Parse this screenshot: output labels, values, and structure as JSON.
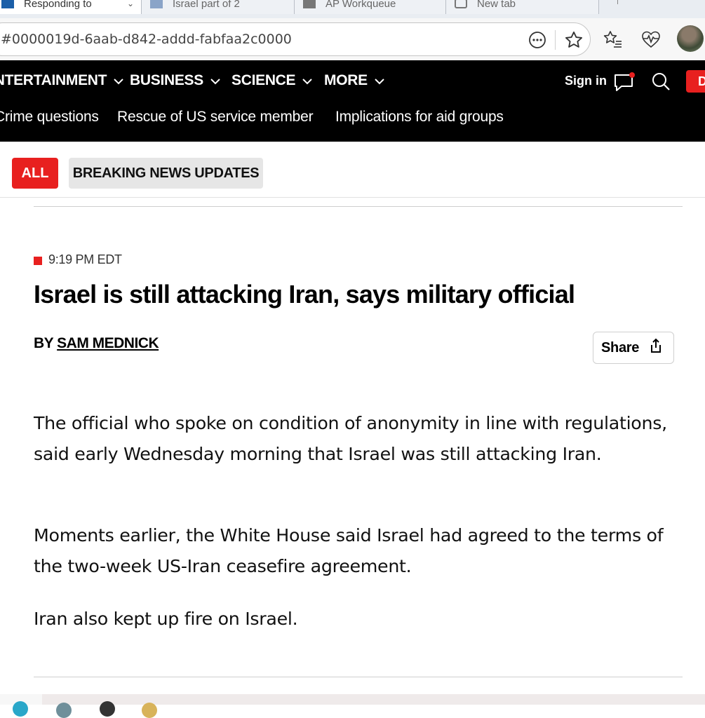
{
  "browser": {
    "tabs": [
      {
        "label": "Responding to"
      },
      {
        "label": "Israel part of 2"
      },
      {
        "label": "AP Workqueue"
      },
      {
        "label": "New tab"
      }
    ],
    "url": "#0000019d-6aab-d842-addd-fabfaa2c0000",
    "toolbar_icons": [
      "more-options-icon",
      "favorite-star-icon",
      "favorites-icon",
      "browser-health-icon",
      "profile-avatar"
    ]
  },
  "nav": {
    "sections": [
      {
        "label": "ENTERTAINMENT"
      },
      {
        "label": "BUSINESS"
      },
      {
        "label": "SCIENCE"
      },
      {
        "label": "MORE"
      }
    ],
    "sign_in": "Sign in",
    "donate": "D",
    "topics": [
      {
        "label": "Crime questions"
      },
      {
        "label": "Rescue of US service member"
      },
      {
        "label": "Implications for aid groups"
      }
    ]
  },
  "filters": {
    "all": "ALL",
    "breaking": "BREAKING NEWS UPDATES"
  },
  "post": {
    "time": "9:19 PM EDT",
    "headline": "Israel is still attacking Iran, says military official",
    "byline_prefix": "BY",
    "author": "SAM MEDNICK",
    "share": "Share",
    "paragraphs": [
      "The official who spoke on condition of anonymity in line with regulations, said early Wednesday morning that Israel was still attacking Iran.",
      "Moments earlier, the White House said Israel had agreed to the terms of the two-week US-Iran ceasefire agreement.",
      "Iran also kept up fire on Israel."
    ]
  },
  "colors": {
    "accent_red": "#e8201f",
    "nav_bg": "#000000",
    "chip_gray": "#e6e6e6"
  }
}
